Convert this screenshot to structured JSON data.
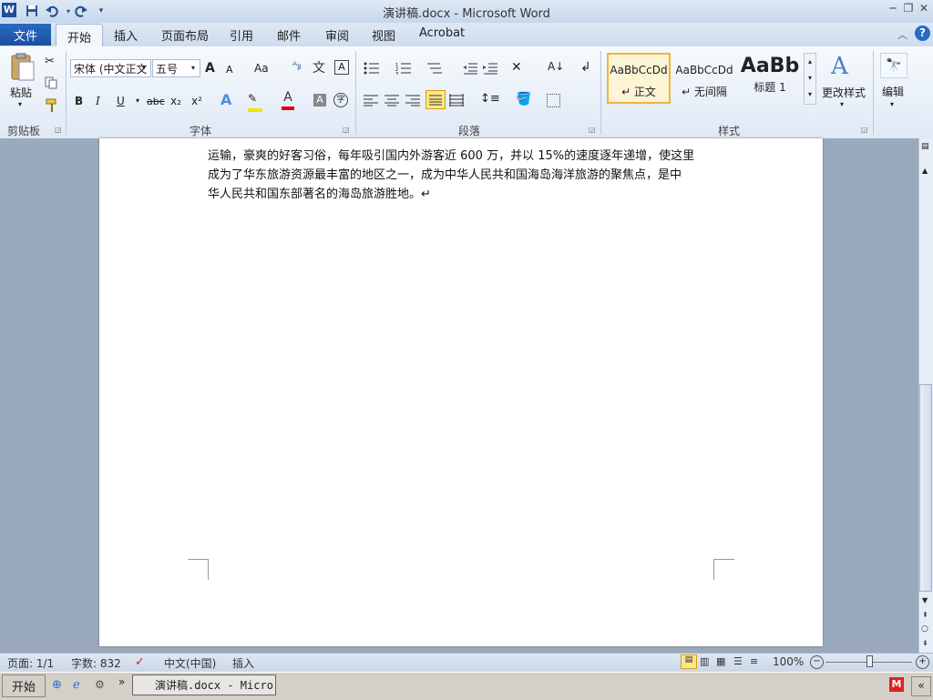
{
  "window": {
    "title": "演讲稿.docx - Microsoft Word",
    "app_icon": "W",
    "qat": {
      "save_icon": "save-icon",
      "undo_icon": "undo-icon",
      "redo_icon": "redo-icon"
    },
    "controls": {
      "minimize": "─",
      "restore": "❐",
      "close": "✕"
    }
  },
  "tabs": {
    "file": "文件",
    "items": [
      "开始",
      "插入",
      "页面布局",
      "引用",
      "邮件",
      "审阅",
      "视图",
      "Acrobat"
    ]
  },
  "ribbon": {
    "clipboard": {
      "paste": "粘贴",
      "label": "剪贴板"
    },
    "font": {
      "label": "字体",
      "font_name": "宋体 (中文正文",
      "font_size": "五号",
      "grow": "A",
      "shrink": "A",
      "change_case": "Aa",
      "bold": "B",
      "italic": "I",
      "underline": "U",
      "strike": "abc",
      "subscript": "x₂",
      "superscript": "x²"
    },
    "paragraph": {
      "label": "段落"
    },
    "styles": {
      "label": "样式",
      "items": [
        {
          "preview": "AaBbCcDd",
          "name": "↵ 正文"
        },
        {
          "preview": "AaBbCcDd",
          "name": "↵ 无间隔"
        },
        {
          "preview": "AaBb",
          "name": "标题 1"
        }
      ],
      "change": "更改样式"
    },
    "editing": {
      "label": "编辑"
    }
  },
  "document": {
    "lines": [
      "运输，豪爽的好客习俗，每年吸引国内外游客近 600 万，并以 15%的速度逐年递增，使这里",
      "成为了华东旅游资源最丰富的地区之一，成为中华人民共和国海岛海洋旅游的聚焦点，是中",
      "华人民共和国东部著名的海岛旅游胜地。↵"
    ]
  },
  "statusbar": {
    "page": "页面: 1/1",
    "words": "字数: 832",
    "language": "中文(中国)",
    "mode": "插入",
    "zoom": "100%"
  },
  "taskbar": {
    "start": "开始",
    "word_task": "演讲稿.docx - Micro...",
    "chevron": "»"
  },
  "colors": {
    "accent": "#2b579a",
    "file_tab": "#1a4f9e",
    "doc_bg": "#9ba9bc"
  }
}
